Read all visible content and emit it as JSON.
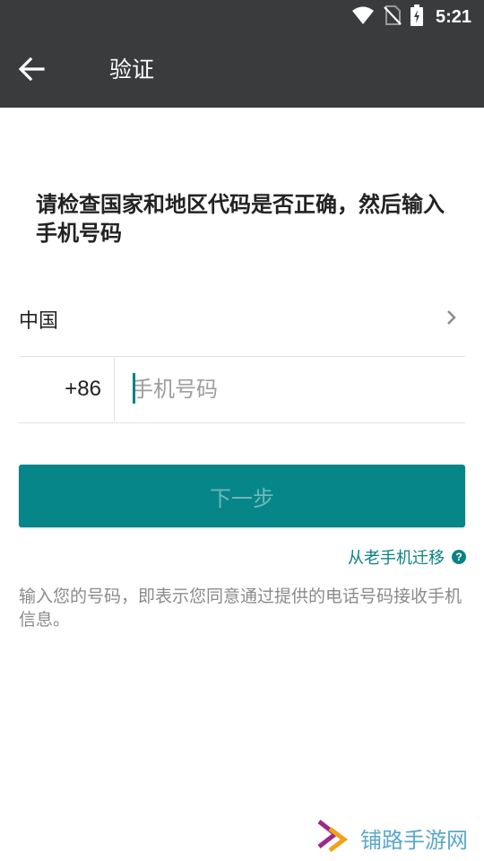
{
  "status_bar": {
    "time": "5:21",
    "icons": [
      "wifi-icon",
      "no-sim-icon",
      "battery-charging-icon"
    ]
  },
  "app_bar": {
    "back_icon": "arrow-left-icon",
    "title": "验证"
  },
  "main": {
    "headline": "请检查国家和地区代码是否正确，然后输入手机号码",
    "country": {
      "name": "中国",
      "chevron_icon": "chevron-right-icon"
    },
    "phone": {
      "country_code": "+86",
      "placeholder": "手机号码",
      "value": ""
    },
    "next_button_label": "下一步",
    "migrate_link": {
      "label": "从老手机迁移",
      "help_icon": "question-circle-icon",
      "help_glyph": "?"
    },
    "disclaimer": "输入您的号码，即表示您同意通过提供的电话号码接收手机信息。"
  },
  "watermark": {
    "text": "铺路手游网"
  },
  "colors": {
    "app_bar": "#393b3d",
    "accent": "#0a8185",
    "button_bg": "#07868a",
    "button_text": "#6cb8ba",
    "watermark_text": "#5aa7c9"
  }
}
